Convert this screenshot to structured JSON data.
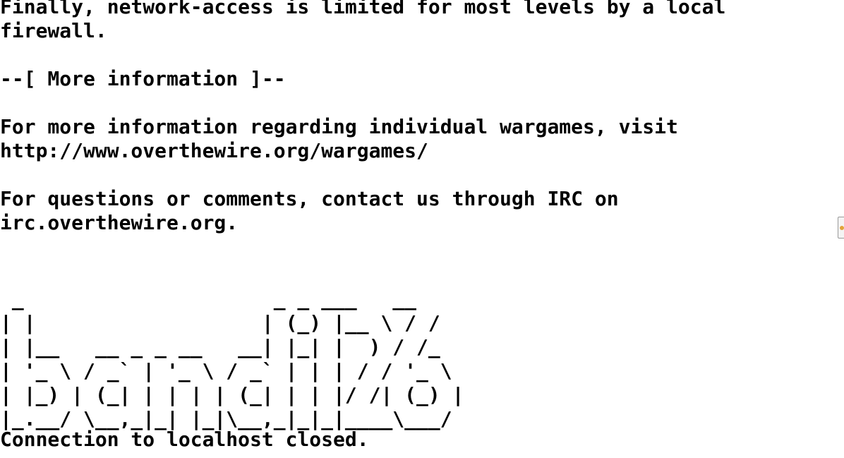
{
  "terminal": {
    "lines": [
      "Finally, network-access is limited for most levels by a local",
      "firewall.",
      "",
      "--[ More information ]--",
      "",
      "For more information regarding individual wargames, visit",
      "http://www.overthewire.org/wargames/",
      "",
      "For questions or comments, contact us through IRC on",
      "irc.overthewire.org."
    ],
    "ascii_art": [
      " _                     _ _ ___   __",
      "| |                   | (_) |__ \\ / /",
      "| |__   __ _ _ __   __| |_| |  ) / /_",
      "| '_ \\ / _` | '_ \\ / _` | | | / / '_ \\",
      "| |_) | (_| | | | | (_| | | |/ /| (_) |",
      "|_.__/ \\__,_|_| |_|\\__,_|_|_|____\\___/"
    ],
    "closed_message": "Connection to localhost closed."
  },
  "edge_widget": {
    "icon": "notification-icon",
    "icon_color": "#e2a33a"
  }
}
